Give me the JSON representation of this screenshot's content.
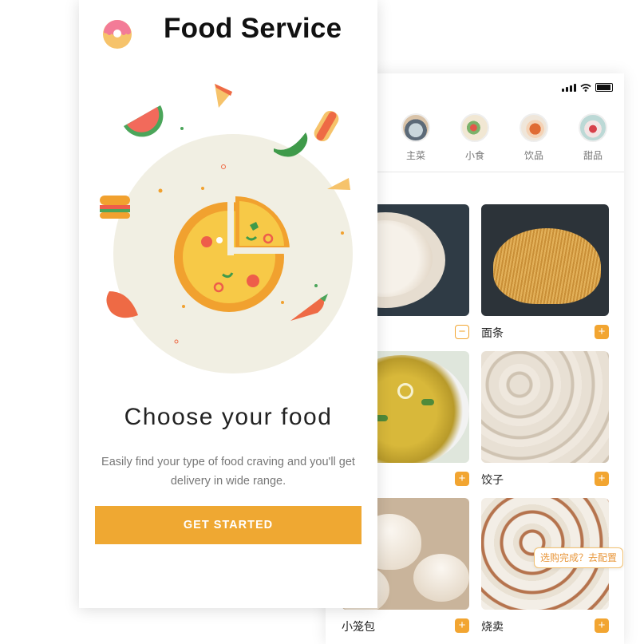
{
  "onboarding": {
    "app_title": "Food Service",
    "heading": "Choose your food",
    "description": "Easily find your type of food craving and you'll get delivery in wide range.",
    "cta_label": "GET STARTED"
  },
  "menu": {
    "categories": [
      {
        "label": "主菜",
        "icon": "main-dish-icon"
      },
      {
        "label": "小食",
        "icon": "snack-icon"
      },
      {
        "label": "饮品",
        "icon": "drink-icon"
      },
      {
        "label": "甜品",
        "icon": "dessert-icon"
      }
    ],
    "items": [
      {
        "name": "",
        "control": "minus"
      },
      {
        "name": "面条",
        "control": "plus"
      },
      {
        "name": "",
        "control": "plus"
      },
      {
        "name": "饺子",
        "control": "plus"
      },
      {
        "name": "小笼包",
        "control": "plus"
      },
      {
        "name": "烧卖",
        "control": "plus"
      }
    ],
    "tooltip": "选购完成？去配置"
  },
  "colors": {
    "accent": "#efa832",
    "illustration_bg": "#f1efe3"
  }
}
